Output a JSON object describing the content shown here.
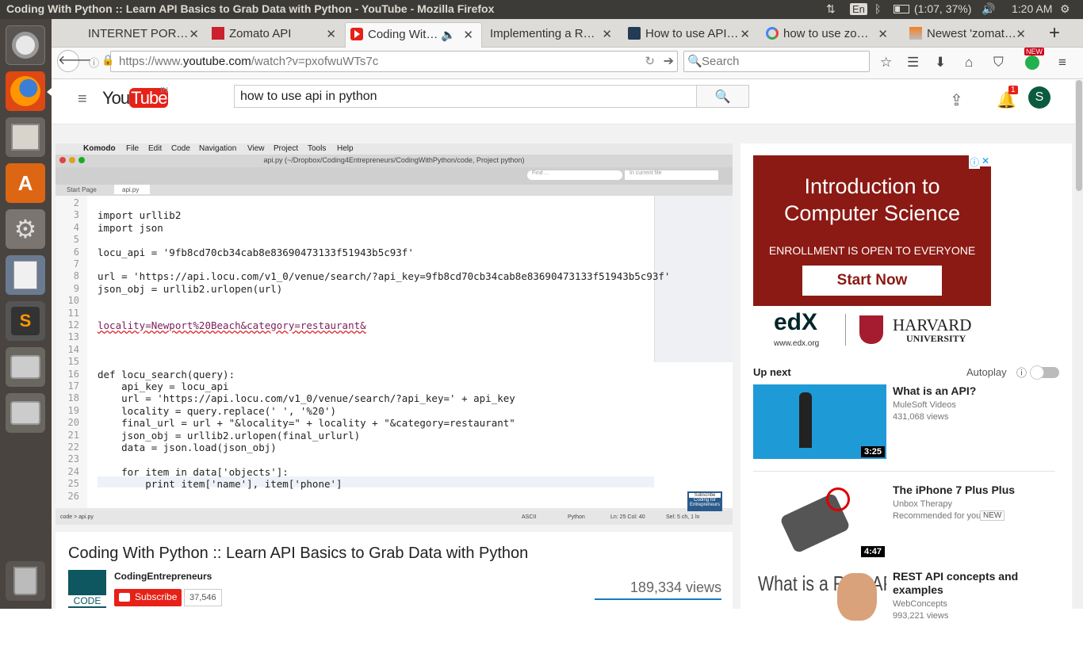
{
  "topbar": {
    "window_title": "Coding With Python :: Learn API Basics to Grab Data with Python - YouTube - Mozilla Firefox",
    "keyboard": "En",
    "battery": "(1:07, 37%)",
    "clock": "1:20 AM"
  },
  "launcher": {
    "items": [
      "ubuntu-dash-icon",
      "firefox-icon",
      "files-icon",
      "software-center-icon",
      "system-settings-icon",
      "text-editor-icon",
      "sublime-text-icon",
      "drive-icon",
      "drive-icon",
      "trash-icon"
    ]
  },
  "tabs": [
    {
      "label": "INTERNET POR…",
      "favicon": "none"
    },
    {
      "label": "Zomato API",
      "favicon": "zomato"
    },
    {
      "label": "Coding Wit…",
      "favicon": "youtube",
      "active": true
    },
    {
      "label": "Implementing a R…",
      "favicon": "none"
    },
    {
      "label": "How to use API…",
      "favicon": "dark"
    },
    {
      "label": "how to use zo…",
      "favicon": "google"
    },
    {
      "label": "Newest 'zomat…",
      "favicon": "stackoverflow"
    }
  ],
  "nav": {
    "url_prefix": "https://www.",
    "url_domain": "youtube.com",
    "url_path": "/watch?v=pxofwuWTs7c",
    "search_placeholder": "Search",
    "new_badge": "NEW"
  },
  "youtube": {
    "logo": "You",
    "logo_tube": "Tube",
    "region": "IN",
    "search_value": "how to use api in python",
    "notif_count": "1",
    "avatar_letter": "S"
  },
  "video": {
    "ide_menu": [
      "Komodo",
      "File",
      "Edit",
      "Code",
      "Navigation",
      "View",
      "Project",
      "Tools",
      "Help"
    ],
    "ide_title": "api.py (~/Dropbox/Coding4Entrepreneurs/CodingWithPython/code, Project python)",
    "tabs": [
      "Start Page",
      "api.py"
    ],
    "find_placeholder": "Find ...",
    "in_file_placeholder": "In current file",
    "code_lines": [
      {
        "n": "2",
        "t": ""
      },
      {
        "n": "3",
        "t": "import urllib2"
      },
      {
        "n": "4",
        "t": "import json"
      },
      {
        "n": "5",
        "t": ""
      },
      {
        "n": "6",
        "t": "locu_api = '9fb8cd70cb34cab8e83690473133f51943b5c93f'"
      },
      {
        "n": "7",
        "t": ""
      },
      {
        "n": "8",
        "t": "url = 'https://api.locu.com/v1_0/venue/search/?api_key=9fb8cd70cb34cab8e83690473133f51943b5c93f'"
      },
      {
        "n": "9",
        "t": "json_obj = urllib2.urlopen(url)"
      },
      {
        "n": "10",
        "t": ""
      },
      {
        "n": "11",
        "t": ""
      },
      {
        "n": "12",
        "t": "locality=Newport%20Beach&category=restaurant&"
      },
      {
        "n": "13",
        "t": ""
      },
      {
        "n": "14",
        "t": ""
      },
      {
        "n": "15",
        "t": ""
      },
      {
        "n": "16",
        "t": "def locu_search(query):"
      },
      {
        "n": "17",
        "t": "    api_key = locu_api"
      },
      {
        "n": "18",
        "t": "    url = 'https://api.locu.com/v1_0/venue/search/?api_key=' + api_key"
      },
      {
        "n": "19",
        "t": "    locality = query.replace(' ', '%20')"
      },
      {
        "n": "20",
        "t": "    final_url = url + \"&locality=\" + locality + \"&category=restaurant\""
      },
      {
        "n": "21",
        "t": "    json_obj = urllib2.urlopen(final_urlurl)"
      },
      {
        "n": "22",
        "t": "    data = json.load(json_obj)"
      },
      {
        "n": "23",
        "t": ""
      },
      {
        "n": "24",
        "t": "    for item in data['objects']:"
      },
      {
        "n": "25",
        "t": "        print item['name'], item['phone']"
      },
      {
        "n": "26",
        "t": ""
      }
    ],
    "status": [
      "code > api.py",
      "ASCII",
      "Python",
      "Ln: 25 Col: 40",
      "Sel: 5 ch, 1 ln"
    ],
    "subscribe_badge": "Subscribe",
    "watermark": "Coding for Entrepreneurs"
  },
  "info": {
    "title": "Coding With Python :: Learn API Basics to Grab Data with Python",
    "channel": "CodingEntrepreneurs",
    "channel_logo_text": "CODE",
    "subscribe": "Subscribe",
    "sub_count": "37,546",
    "views": "189,334 views"
  },
  "ad": {
    "title": "Introduction to Computer Science",
    "subtitle": "ENROLLMENT IS OPEN TO EVERYONE",
    "cta": "Start Now",
    "edx": "edX",
    "edx_url": "www.edx.org",
    "harvard": "HARVARD",
    "university": "UNIVERSITY"
  },
  "upnext": {
    "label": "Up next",
    "autoplay": "Autoplay",
    "videos": [
      {
        "title": "What is an API?",
        "channel": "MuleSoft Videos",
        "meta": "431,068 views",
        "duration": "3:25"
      },
      {
        "title": "The iPhone 7 Plus Plus",
        "channel": "Unbox Therapy",
        "meta": "Recommended for you",
        "badge": "NEW",
        "duration": "4:47"
      },
      {
        "title": "REST API concepts and examples",
        "channel": "WebConcepts",
        "meta": "993,221 views",
        "thumb_text": "What is a Rest API?"
      }
    ]
  },
  "colors": {
    "youtube_red": "#e62117",
    "ad_bg": "#8b1a14",
    "ubuntu_orange": "#dd4814"
  }
}
